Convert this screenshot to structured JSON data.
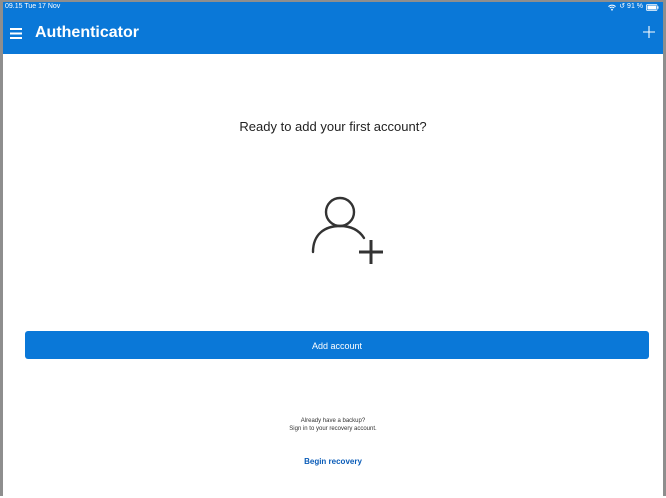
{
  "status_bar": {
    "time": "09.15 Tue 17 Nov",
    "indicators": "↺ 91 %",
    "icons": [
      "wifi-icon",
      "battery-icon"
    ]
  },
  "nav": {
    "title": "Authenticator",
    "menu_icon": "hamburger-menu-icon",
    "add_icon": "plus-icon"
  },
  "main": {
    "headline": "Ready to add your first account?",
    "illustration_icon": "person-add-icon",
    "add_account_label": "Add account",
    "backup_line1": "Already have a backup?",
    "backup_line2": "Sign in to your recovery account.",
    "begin_recovery_label": "Begin recovery"
  },
  "colors": {
    "accent": "#0a78d8",
    "link": "#0a5cb8",
    "text": "#222222"
  }
}
